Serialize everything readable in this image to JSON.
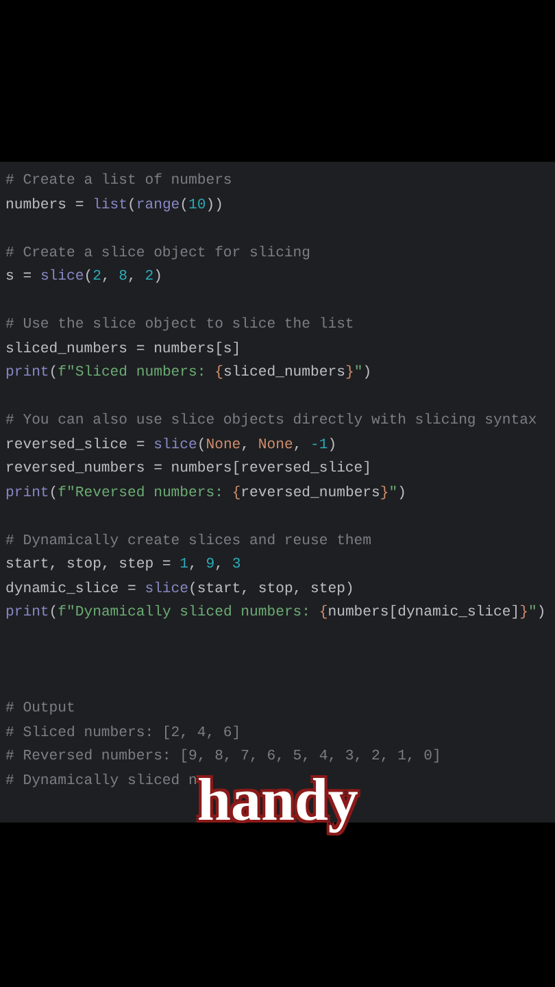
{
  "editor": {
    "lines": [
      {
        "kind": "code",
        "segments": [
          {
            "kind": "comment",
            "text": "# Create a list of numbers"
          }
        ]
      },
      {
        "kind": "code",
        "segments": [
          {
            "kind": "plain",
            "text": "numbers = "
          },
          {
            "kind": "builtin",
            "text": "list"
          },
          {
            "kind": "plain",
            "text": "("
          },
          {
            "kind": "builtin",
            "text": "range"
          },
          {
            "kind": "plain",
            "text": "("
          },
          {
            "kind": "number",
            "text": "10"
          },
          {
            "kind": "plain",
            "text": "))"
          }
        ]
      },
      {
        "kind": "blank"
      },
      {
        "kind": "code",
        "segments": [
          {
            "kind": "comment",
            "text": "# Create a slice object for slicing"
          }
        ]
      },
      {
        "kind": "code",
        "segments": [
          {
            "kind": "plain",
            "text": "s = "
          },
          {
            "kind": "builtin",
            "text": "slice"
          },
          {
            "kind": "plain",
            "text": "("
          },
          {
            "kind": "number",
            "text": "2"
          },
          {
            "kind": "plain",
            "text": ", "
          },
          {
            "kind": "number",
            "text": "8"
          },
          {
            "kind": "plain",
            "text": ", "
          },
          {
            "kind": "number",
            "text": "2"
          },
          {
            "kind": "plain",
            "text": ")"
          }
        ]
      },
      {
        "kind": "blank"
      },
      {
        "kind": "code",
        "segments": [
          {
            "kind": "comment",
            "text": "# Use the slice object to slice the list"
          }
        ]
      },
      {
        "kind": "code",
        "segments": [
          {
            "kind": "plain",
            "text": "sliced_numbers = numbers[s]"
          }
        ]
      },
      {
        "kind": "code",
        "segments": [
          {
            "kind": "builtin",
            "text": "print"
          },
          {
            "kind": "plain",
            "text": "("
          },
          {
            "kind": "string",
            "text": "f\"Sliced numbers: "
          },
          {
            "kind": "brace",
            "text": "{"
          },
          {
            "kind": "plain",
            "text": "sliced_numbers"
          },
          {
            "kind": "brace",
            "text": "}"
          },
          {
            "kind": "string",
            "text": "\""
          },
          {
            "kind": "plain",
            "text": ")"
          }
        ]
      },
      {
        "kind": "blank"
      },
      {
        "kind": "code",
        "segments": [
          {
            "kind": "comment",
            "text": "# You can also use slice objects directly with slicing syntax"
          }
        ]
      },
      {
        "kind": "code",
        "segments": [
          {
            "kind": "plain",
            "text": "reversed_slice = "
          },
          {
            "kind": "builtin",
            "text": "slice"
          },
          {
            "kind": "plain",
            "text": "("
          },
          {
            "kind": "keyword",
            "text": "None"
          },
          {
            "kind": "plain",
            "text": ", "
          },
          {
            "kind": "keyword",
            "text": "None"
          },
          {
            "kind": "plain",
            "text": ", "
          },
          {
            "kind": "number",
            "text": "-1"
          },
          {
            "kind": "plain",
            "text": ")"
          }
        ]
      },
      {
        "kind": "code",
        "segments": [
          {
            "kind": "plain",
            "text": "reversed_numbers = numbers[reversed_slice]"
          }
        ]
      },
      {
        "kind": "code",
        "segments": [
          {
            "kind": "builtin",
            "text": "print"
          },
          {
            "kind": "plain",
            "text": "("
          },
          {
            "kind": "string",
            "text": "f\"Reversed numbers: "
          },
          {
            "kind": "brace",
            "text": "{"
          },
          {
            "kind": "plain",
            "text": "reversed_numbers"
          },
          {
            "kind": "brace",
            "text": "}"
          },
          {
            "kind": "string",
            "text": "\""
          },
          {
            "kind": "plain",
            "text": ")"
          }
        ]
      },
      {
        "kind": "blank"
      },
      {
        "kind": "code",
        "segments": [
          {
            "kind": "comment",
            "text": "# Dynamically create slices and reuse them"
          }
        ]
      },
      {
        "kind": "code",
        "segments": [
          {
            "kind": "plain",
            "text": "start, stop, step = "
          },
          {
            "kind": "number",
            "text": "1"
          },
          {
            "kind": "plain",
            "text": ", "
          },
          {
            "kind": "number",
            "text": "9"
          },
          {
            "kind": "plain",
            "text": ", "
          },
          {
            "kind": "number",
            "text": "3"
          }
        ]
      },
      {
        "kind": "code",
        "segments": [
          {
            "kind": "plain",
            "text": "dynamic_slice = "
          },
          {
            "kind": "builtin",
            "text": "slice"
          },
          {
            "kind": "plain",
            "text": "(start, stop, step)"
          }
        ]
      },
      {
        "kind": "code",
        "segments": [
          {
            "kind": "builtin",
            "text": "print"
          },
          {
            "kind": "plain",
            "text": "("
          },
          {
            "kind": "string",
            "text": "f\"Dynamically sliced numbers: "
          },
          {
            "kind": "brace",
            "text": "{"
          },
          {
            "kind": "plain",
            "text": "numbers[dynamic_slice]"
          },
          {
            "kind": "brace",
            "text": "}"
          },
          {
            "kind": "string",
            "text": "\""
          },
          {
            "kind": "plain",
            "text": ")"
          }
        ]
      },
      {
        "kind": "blank"
      },
      {
        "kind": "blank"
      },
      {
        "kind": "blank"
      },
      {
        "kind": "code",
        "segments": [
          {
            "kind": "comment",
            "text": "# Output"
          }
        ]
      },
      {
        "kind": "code",
        "segments": [
          {
            "kind": "comment",
            "text": "# Sliced numbers: [2, 4, 6]"
          }
        ]
      },
      {
        "kind": "code",
        "segments": [
          {
            "kind": "comment",
            "text": "# Reversed numbers: [9, 8, 7, 6, 5, 4, 3, 2, 1, 0]"
          }
        ]
      },
      {
        "kind": "code",
        "segments": [
          {
            "kind": "comment",
            "text": "# Dynamically sliced n"
          }
        ]
      }
    ]
  },
  "caption": "handy"
}
